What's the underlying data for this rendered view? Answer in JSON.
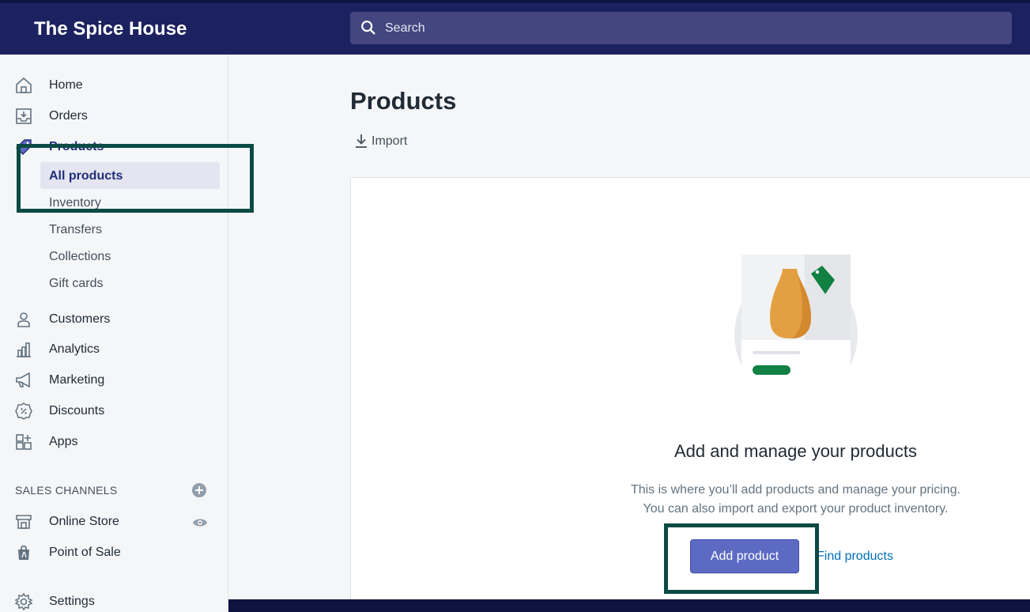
{
  "header": {
    "store_name": "The Spice House",
    "search_placeholder": "Search"
  },
  "sidebar": {
    "items": [
      {
        "label": "Home",
        "icon": "home-icon"
      },
      {
        "label": "Orders",
        "icon": "orders-icon"
      },
      {
        "label": "Products",
        "icon": "tag-icon"
      },
      {
        "label": "Customers",
        "icon": "person-icon"
      },
      {
        "label": "Analytics",
        "icon": "chart-icon"
      },
      {
        "label": "Marketing",
        "icon": "megaphone-icon"
      },
      {
        "label": "Discounts",
        "icon": "discount-icon"
      },
      {
        "label": "Apps",
        "icon": "apps-icon"
      }
    ],
    "product_subitems": [
      {
        "label": "All products",
        "active": true
      },
      {
        "label": "Inventory",
        "active": false
      },
      {
        "label": "Transfers",
        "active": false
      },
      {
        "label": "Collections",
        "active": false
      },
      {
        "label": "Gift cards",
        "active": false
      }
    ],
    "sales_channels_heading": "SALES CHANNELS",
    "channels": [
      {
        "label": "Online Store",
        "icon": "store-icon"
      },
      {
        "label": "Point of Sale",
        "icon": "shopping-bag-icon"
      }
    ],
    "settings_label": "Settings"
  },
  "main": {
    "title": "Products",
    "import_label": "Import",
    "empty_title": "Add and manage your products",
    "empty_desc_line1": "This is where you’ll add products and manage your pricing.",
    "empty_desc_line2": "You can also import and export your product inventory.",
    "add_product_label": "Add product",
    "find_products_label": "Find products"
  },
  "colors": {
    "top_bar": "#1c2260",
    "primary_button": "#5c6ac4",
    "highlight_border": "#0c4a44",
    "link": "#006fbb"
  }
}
